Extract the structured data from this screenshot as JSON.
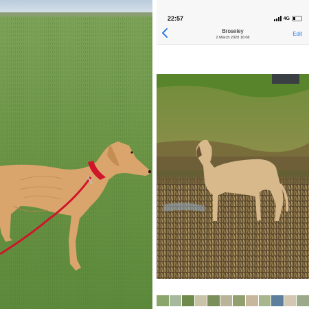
{
  "status_bar": {
    "time": "22:57",
    "network": "4G"
  },
  "nav": {
    "title": "Broseley",
    "subtitle": "2 March 2020  16:08",
    "edit_label": "Edit"
  },
  "colors": {
    "accent": "#2f7de1",
    "grass": "#6f9648",
    "dog_coat": "#d9a56d",
    "collar": "#d0142a"
  },
  "thumbnails": [
    "#8aa66a",
    "#a8b89c",
    "#6f8a4a",
    "#c9c3a8",
    "#7a8f5a",
    "#b9b39a",
    "#91a06e",
    "#c7b79d",
    "#a7b68f",
    "#5e7e9e",
    "#d2c8b2",
    "#9ca98b"
  ]
}
